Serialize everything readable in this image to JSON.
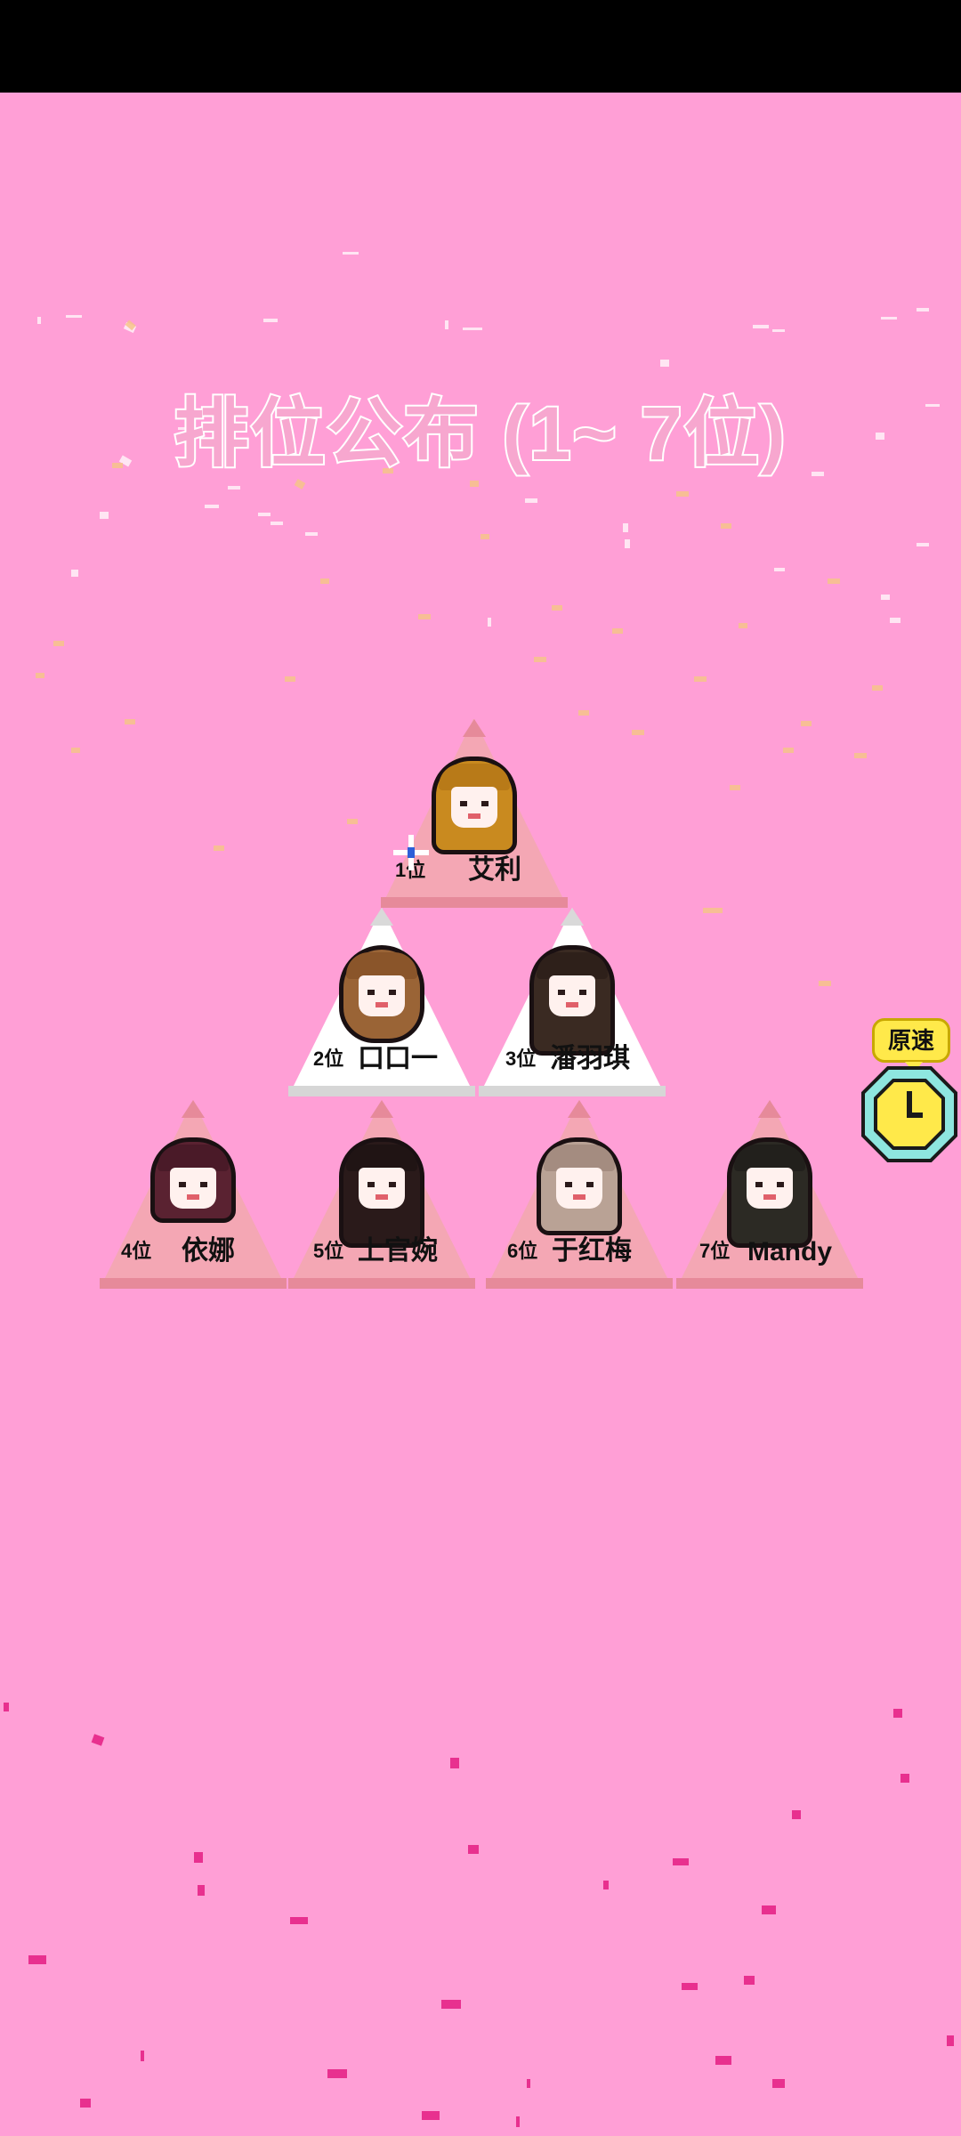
{
  "title": "排位公布 (1~ 7位)",
  "speed_button": {
    "label": "原速",
    "icon": "clock-icon"
  },
  "colors": {
    "background": "#ff9fd6",
    "title_fill": "#f7a7cf",
    "pink_card": "#f4a7b4",
    "pink_card_dark": "#e68a9a",
    "white_card": "#ffffff",
    "speed_bubble": "#ffe94a",
    "clock_ring": "#8ee6df"
  },
  "rankings": [
    {
      "rank": "1位",
      "name": "艾利",
      "card": "pink",
      "hair": "#c98a1f",
      "bang": "#b87a18"
    },
    {
      "rank": "2位",
      "name": "口口一",
      "card": "white",
      "hair": "#9a6436",
      "bang": "#8a552a"
    },
    {
      "rank": "3位",
      "name": "潘羽琪",
      "card": "white",
      "hair": "#3a2a22",
      "bang": "#2e201a"
    },
    {
      "rank": "4位",
      "name": "依娜",
      "card": "pink",
      "hair": "#5a2231",
      "bang": "#4a1a28"
    },
    {
      "rank": "5位",
      "name": "上官婉",
      "card": "pink",
      "hair": "#2a1a1a",
      "bang": "#201414"
    },
    {
      "rank": "6位",
      "name": "于红梅",
      "card": "pink",
      "hair": "#b9a295",
      "bang": "#a48c80"
    },
    {
      "rank": "7位",
      "name": "Mandy",
      "card": "pink",
      "hair": "#2c2a24",
      "bang": "#22201c"
    }
  ]
}
